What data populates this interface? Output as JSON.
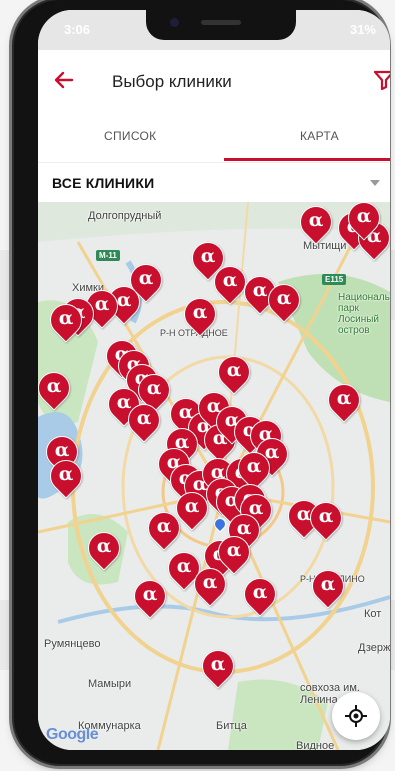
{
  "statusbar": {
    "time": "3:06",
    "battery": "31%"
  },
  "header": {
    "title": "Выбор клиники"
  },
  "tabs": [
    {
      "label": "СПИСОК"
    },
    {
      "label": "КАРТА"
    }
  ],
  "filter": {
    "selected": "ВСЕ КЛИНИКИ"
  },
  "map": {
    "labels": {
      "dolgoprudny": "Долгопрудный",
      "mytishchi": "Мытищи",
      "khimki": "Химки",
      "otradnoe": "Р-Н ОТРАДНОЕ",
      "natsionalny": "Национальный парк Лосиный остров",
      "pn_inno": "Р-Н ЛЮБЛИНО",
      "kot": "Кот",
      "dzerzh": "Дзерж",
      "rumyantsevo": "Румянцево",
      "mamyri": "Мамыри",
      "sovkhoz": "совхоза им. Ленина",
      "kommunarka": "Коммунарка",
      "bittsa": "Битца",
      "vidnoe": "Видное",
      "google": "Google"
    },
    "road_badges": {
      "m11": "M-11",
      "e115": "E115"
    },
    "pin_symbol": "α",
    "pin_count": 58,
    "colors": {
      "pin": "#c8102e",
      "accent": "#c8102e"
    }
  },
  "icons": {
    "back": "arrow-left-icon",
    "filter": "filter-funnel-icon",
    "locate": "crosshair-locate-icon"
  }
}
